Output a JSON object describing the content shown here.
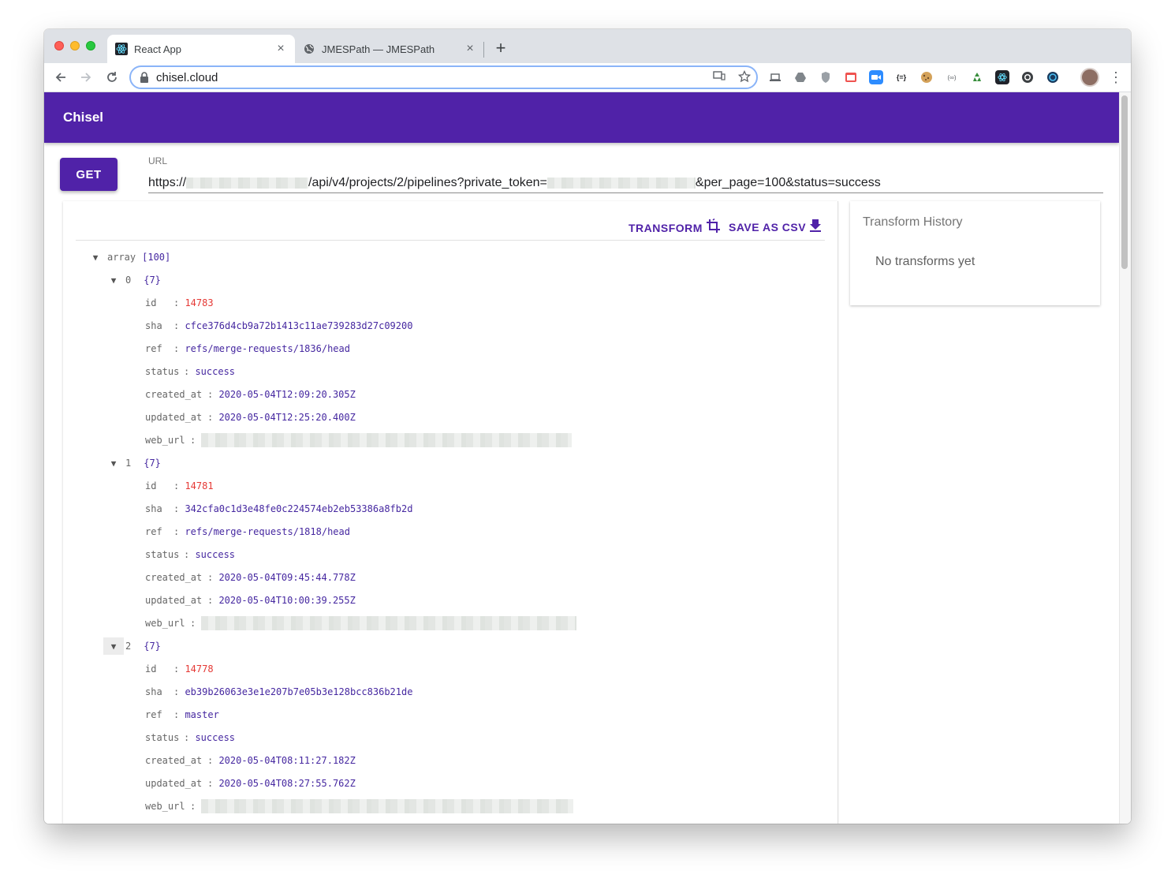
{
  "browser": {
    "tabs": [
      {
        "title": "React App",
        "close": "×"
      },
      {
        "title": "JMESPath — JMESPath",
        "close": "×"
      }
    ],
    "new_tab": "+",
    "address": "chisel.cloud"
  },
  "app": {
    "title": "Chisel",
    "get_label": "GET",
    "url_label": "URL",
    "url_parts": {
      "prefix": "https://",
      "path": "/api/v4/projects/2/pipelines?private_token=",
      "suffix": "&per_page=100&status=success"
    },
    "transform_label": "TRANSFORM",
    "save_csv_label": "SAVE AS CSV",
    "history_title": "Transform History",
    "history_empty": "No transforms yet"
  },
  "tree": {
    "root_key": "array",
    "root_count": "[100]",
    "items": [
      {
        "index": "0",
        "count": "{7}",
        "id": "14783",
        "sha": "cfce376d4cb9a72b1413c11ae739283d27c09200",
        "ref": "refs/merge-requests/1836/head",
        "status": "success",
        "created_at": "2020-05-04T12:09:20.305Z",
        "updated_at": "2020-05-04T12:25:20.400Z"
      },
      {
        "index": "1",
        "count": "{7}",
        "id": "14781",
        "sha": "342cfa0c1d3e48fe0c224574eb2eb53386a8fb2d",
        "ref": "refs/merge-requests/1818/head",
        "status": "success",
        "created_at": "2020-05-04T09:45:44.778Z",
        "updated_at": "2020-05-04T10:00:39.255Z"
      },
      {
        "index": "2",
        "count": "{7}",
        "id": "14778",
        "sha": "eb39b26063e3e1e207b7e05b3e128bcc836b21de",
        "ref": "master",
        "status": "success",
        "created_at": "2020-05-04T08:11:27.182Z",
        "updated_at": "2020-05-04T08:27:55.762Z"
      }
    ],
    "labels": {
      "id": "id",
      "sha": "sha",
      "ref": "ref",
      "status": "status",
      "created_at": "created_at",
      "updated_at": "updated_at",
      "web_url": "web_url"
    }
  },
  "colors": {
    "primary": "#5022a8",
    "number": "#e53935",
    "string": "#4527a0"
  }
}
